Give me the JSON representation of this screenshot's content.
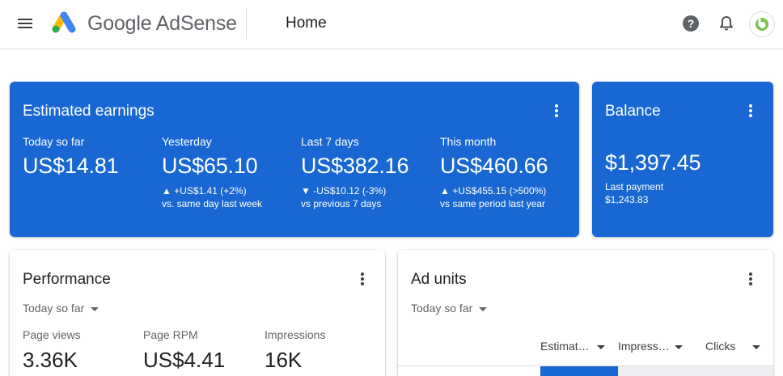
{
  "header": {
    "logo_text": "Google AdSense",
    "page_title": "Home"
  },
  "earnings": {
    "title": "Estimated earnings",
    "metrics": [
      {
        "label": "Today so far",
        "value": "US$14.81",
        "change": "",
        "compare": ""
      },
      {
        "label": "Yesterday",
        "value": "US$65.10",
        "change": "▲ +US$1.41 (+2%)",
        "compare": "vs. same day last week"
      },
      {
        "label": "Last 7 days",
        "value": "US$382.16",
        "change": "▼ -US$10.12 (-3%)",
        "compare": "vs previous 7 days"
      },
      {
        "label": "This month",
        "value": "US$460.66",
        "change": "▲ +US$455.15 (>500%)",
        "compare": "vs same period last year"
      }
    ]
  },
  "balance": {
    "title": "Balance",
    "value": "$1,397.45",
    "last_payment_label": "Last payment",
    "last_payment_value": "$1,243.83"
  },
  "performance": {
    "title": "Performance",
    "range": "Today so far",
    "metrics": [
      {
        "label": "Page views",
        "value": "3.36K"
      },
      {
        "label": "Page RPM",
        "value": "US$4.41"
      },
      {
        "label": "Impressions",
        "value": "16K"
      }
    ]
  },
  "ad_units": {
    "title": "Ad units",
    "range": "Today so far",
    "columns": [
      "Estimat…",
      "Impress…",
      "Clicks"
    ]
  },
  "colors": {
    "brand_blue": "#1967d2",
    "avatar_green": "#7cc243"
  }
}
